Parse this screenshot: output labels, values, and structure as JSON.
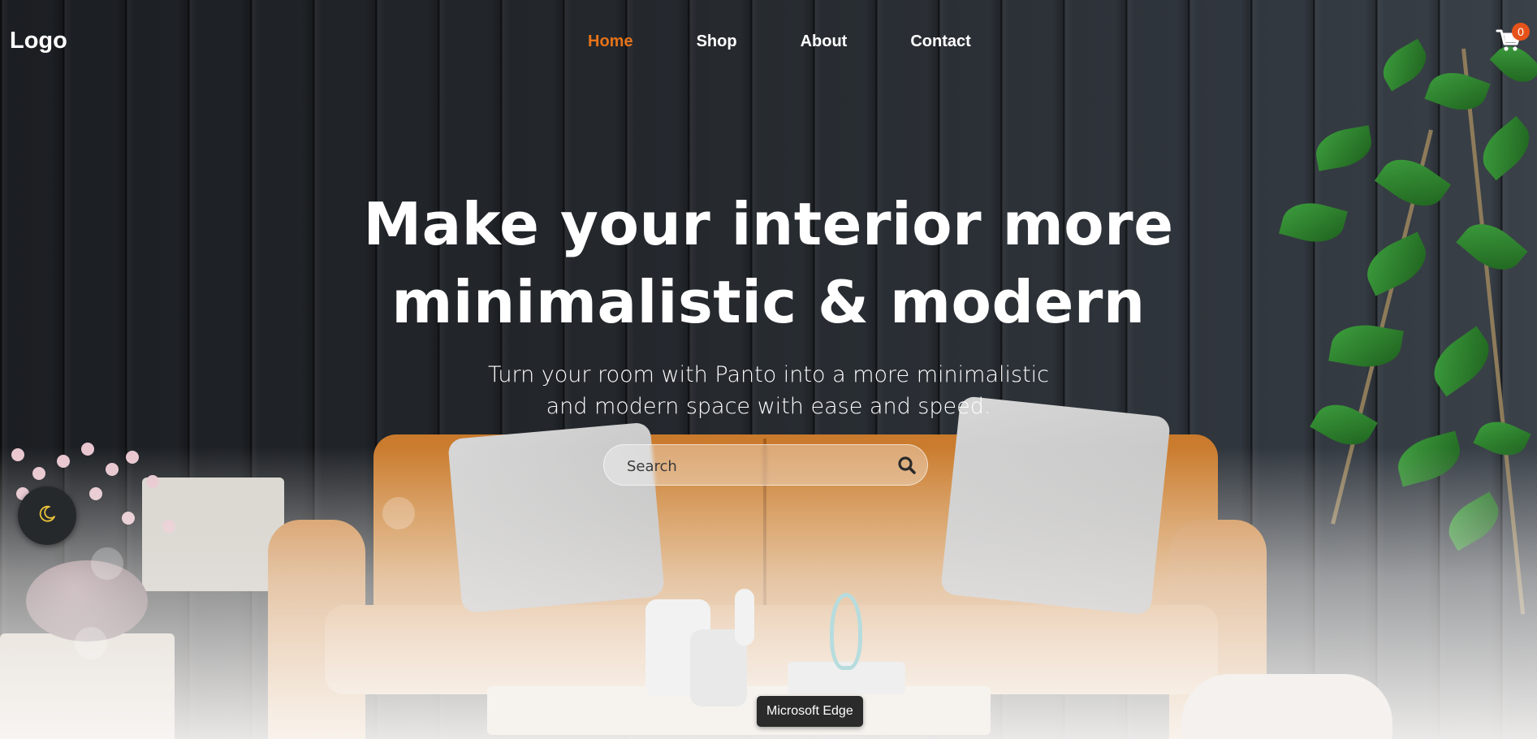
{
  "nav": {
    "logo": "Logo",
    "links": [
      {
        "label": "Home",
        "active": true
      },
      {
        "label": "Shop",
        "active": false
      },
      {
        "label": "About",
        "active": false
      },
      {
        "label": "Contact",
        "active": false
      }
    ],
    "cart": {
      "icon": "cart-icon",
      "count": "0"
    }
  },
  "hero": {
    "title_line1": "Make your interior more",
    "title_line2": "minimalistic & modern",
    "subtitle_line1": "Turn your room with Panto into a more minimalistic",
    "subtitle_line2": "and modern space with ease and speed.",
    "search": {
      "placeholder": "Search",
      "value": "",
      "icon": "search-icon"
    }
  },
  "theme_toggle": {
    "icon": "moon-icon"
  },
  "tooltip": {
    "text": "Microsoft Edge"
  },
  "colors": {
    "accent": "#e6731a",
    "badge": "#e6531a",
    "moon": "#e8c33a",
    "text": "#ffffff"
  }
}
